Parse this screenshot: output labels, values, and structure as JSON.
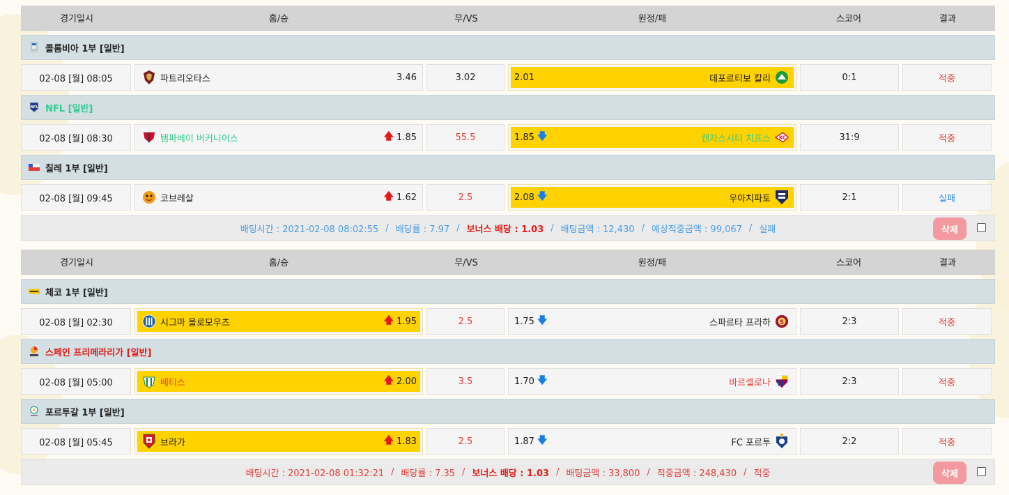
{
  "headers": {
    "date": "경기일시",
    "home": "홈/승",
    "draw": "무/VS",
    "away": "원정/패",
    "score": "스코어",
    "result": "결과"
  },
  "slips": [
    {
      "games": [
        {
          "league": "콜롬비아 1부 [일반]",
          "league_style": "default",
          "date": "02-08 [월] 08:05",
          "home_team": "파트리오타스",
          "home_odds": "3.46",
          "home_arrow": "",
          "draw": "3.02",
          "draw_style": "normal",
          "away_odds": "2.01",
          "away_arrow": "",
          "away_team": "데포르티보 칼리",
          "score": "0:1",
          "result": "적중",
          "result_style": "hit",
          "pick": "away"
        },
        {
          "league": "NFL [일반]",
          "league_style": "green",
          "date": "02-08 [월] 08:30",
          "home_team": "탬파베이 버커니어스",
          "home_odds": "1.85",
          "home_arrow": "up",
          "draw": "55.5",
          "draw_style": "red",
          "away_odds": "1.85",
          "away_arrow": "down",
          "away_team": "캔자스시티 치프스",
          "score": "31:9",
          "result": "적중",
          "result_style": "hit",
          "pick": "away"
        },
        {
          "league": "칠레 1부 [일반]",
          "league_style": "default",
          "date": "02-08 [월] 09:45",
          "home_team": "코브레살",
          "home_odds": "1.62",
          "home_arrow": "up",
          "draw": "2.5",
          "draw_style": "red",
          "away_odds": "2.08",
          "away_arrow": "down",
          "away_team": "우아치파토",
          "score": "2:1",
          "result": "실패",
          "result_style": "miss",
          "pick": "away"
        }
      ],
      "summary": {
        "style": "blue",
        "time": "배팅시간 : 2021-02-08 08:02:55",
        "rate": "배당률 : 7.97",
        "bonus": "보너스 배당 : 1.03",
        "amount": "배팅금액 : 12,430",
        "win": "예상적중금액 : 99,067",
        "status": "실패",
        "delete_label": "삭제"
      }
    },
    {
      "games": [
        {
          "league": "체코 1부 [일반]",
          "league_style": "default",
          "date": "02-08 [월] 02:30",
          "home_team": "시그마 올로모우츠",
          "home_odds": "1.95",
          "home_arrow": "up",
          "draw": "2.5",
          "draw_style": "red",
          "away_odds": "1.75",
          "away_arrow": "down",
          "away_team": "스파르타 프라하",
          "score": "2:3",
          "result": "적중",
          "result_style": "hit",
          "pick": "home"
        },
        {
          "league": "스페인 프리메라리가 [일반]",
          "league_style": "red",
          "date": "02-08 [월] 05:00",
          "home_team": "베티스",
          "home_odds": "2.00",
          "home_arrow": "up",
          "draw": "3.5",
          "draw_style": "red",
          "away_odds": "1.70",
          "away_arrow": "down",
          "away_team": "바르셀로나",
          "score": "2:3",
          "result": "적중",
          "result_style": "hit",
          "pick": "home"
        },
        {
          "league": "포르투갈 1부 [일반]",
          "league_style": "default",
          "date": "02-08 [월] 05:45",
          "home_team": "브라가",
          "home_odds": "1.83",
          "home_arrow": "up",
          "draw": "2.5",
          "draw_style": "red",
          "away_odds": "1.87",
          "away_arrow": "down",
          "away_team": "FC 포르투",
          "score": "2:2",
          "result": "적중",
          "result_style": "hit",
          "pick": "home"
        }
      ],
      "summary": {
        "style": "red",
        "time": "배팅시간 : 2021-02-08 01:32:21",
        "rate": "배당률 : 7.35",
        "bonus": "보너스 배당 : 1.03",
        "amount": "배팅금액 : 33,800",
        "win": "적중금액 : 248,430",
        "status": "적중",
        "delete_label": "삭제"
      }
    }
  ],
  "icons": {
    "league": [
      "colombia-league-icon",
      "nfl-icon",
      "chile-league-icon",
      "czech-league-icon",
      "laliga-icon",
      "portugal-league-icon"
    ],
    "up_arrow": "arrow-up-icon",
    "down_arrow": "arrow-down-icon"
  },
  "colors": {
    "header_bg": "#d4d4d4",
    "league_bg": "#d3dfe3",
    "pick_bg": "#ffd200",
    "hit": "#e0403f",
    "miss": "#3a8fe0",
    "up": "#e21a1a",
    "down": "#1a7fe2",
    "delete_button": "#f29aa0"
  }
}
